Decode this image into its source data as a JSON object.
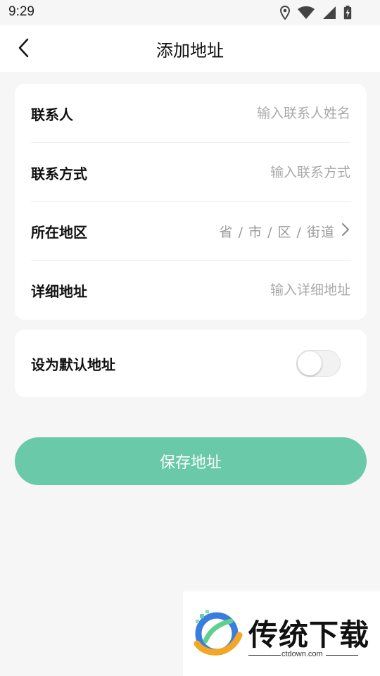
{
  "status_bar": {
    "time": "9:29",
    "icons": [
      "location-icon",
      "wifi-icon",
      "signal-icon",
      "battery-charging-icon"
    ]
  },
  "nav": {
    "title": "添加地址",
    "back_icon": "chevron-left-icon"
  },
  "form": {
    "contact": {
      "label": "联系人",
      "placeholder": "输入联系人姓名",
      "value": ""
    },
    "phone": {
      "label": "联系方式",
      "placeholder": "输入联系方式",
      "value": ""
    },
    "region": {
      "label": "所在地区",
      "placeholder": "省 / 市 / 区 / 街道",
      "icon": "chevron-right-icon"
    },
    "detail": {
      "label": "详细地址",
      "placeholder": "输入详细地址",
      "value": ""
    }
  },
  "default_address": {
    "label": "设为默认地址",
    "enabled": false
  },
  "save_button": {
    "label": "保存地址"
  },
  "colors": {
    "accent": "#6ac9a9",
    "background": "#f6f6f6",
    "card": "#ffffff",
    "placeholder": "#a9a9a9"
  },
  "watermark": {
    "title": "传统下载",
    "url": "ctdown.com"
  }
}
